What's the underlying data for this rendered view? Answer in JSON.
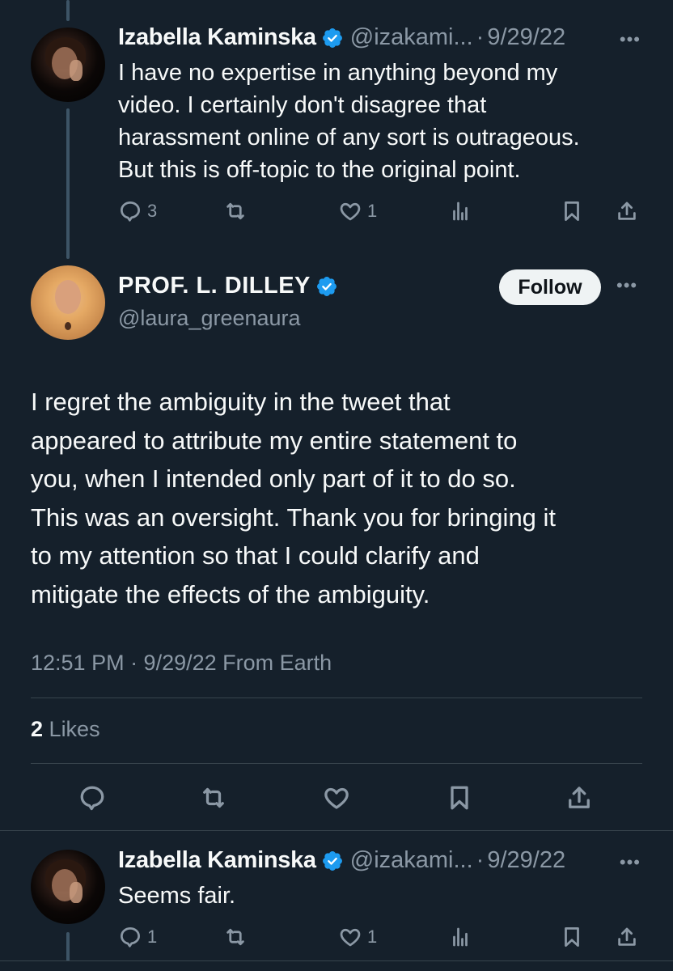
{
  "colors": {
    "background": "#15202b",
    "text_primary": "#f7f9f9",
    "text_secondary": "#8b98a5",
    "verified_blue": "#1d9bf0",
    "divider": "#38444d",
    "thread_line": "#3d5466",
    "follow_bg": "#eff3f4"
  },
  "reply1": {
    "author_name": "Izabella Kaminska",
    "handle": "@izakami...",
    "separator": "·",
    "date": "9/29/22",
    "more": "•••",
    "lines": [
      "I have no expertise in anything beyond my",
      "video. I certainly don't disagree that",
      "harassment online of any sort is outrageous.",
      "But this is off-topic to the original point."
    ],
    "replies": "3",
    "retweets": "",
    "likes": "1",
    "views": ""
  },
  "main_tweet": {
    "author_name": "PROF. L. DILLEY",
    "handle": "@laura_greenaura",
    "follow_label": "Follow",
    "more": "•••",
    "lines": [
      "I regret the ambiguity in the tweet that",
      "appeared to attribute my entire statement to",
      "you, when I intended only part of it to do so.",
      "This was an oversight. Thank you for bringing it",
      "to my attention so that I could clarify and",
      "mitigate the effects of the ambiguity."
    ],
    "meta": "12:51 PM · 9/29/22 From Earth",
    "likes_count": "2",
    "likes_label": "Likes"
  },
  "reply2": {
    "author_name": "Izabella Kaminska",
    "handle": "@izakami...",
    "separator": "·",
    "date": "9/29/22",
    "more": "•••",
    "text": "Seems fair.",
    "replies": "1",
    "retweets": "",
    "likes": "1",
    "views": ""
  }
}
